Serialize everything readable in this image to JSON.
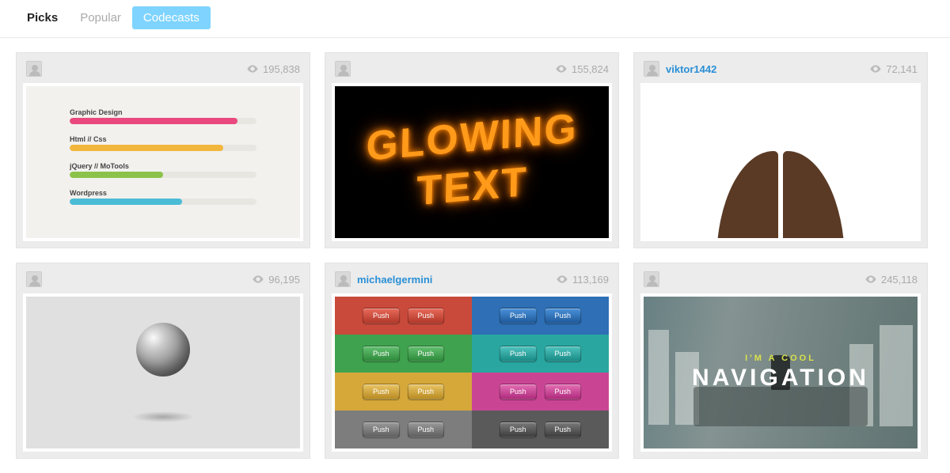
{
  "tabs": {
    "picks": "Picks",
    "popular": "Popular",
    "codecasts": "Codecasts"
  },
  "cards": [
    {
      "author": "",
      "views": "195,838",
      "skills": [
        "Graphic Design",
        "Html // Css",
        "jQuery // MoTools",
        "Wordpress"
      ]
    },
    {
      "author": "",
      "views": "155,824",
      "glow_line1": "GLOWING",
      "glow_line2": "TEXT"
    },
    {
      "author": "viktor1442",
      "views": "72,141"
    },
    {
      "author": "",
      "views": "96,195"
    },
    {
      "author": "michaelgermini",
      "views": "113,169",
      "push_label": "Push"
    },
    {
      "author": "",
      "views": "245,118",
      "hero_sub": "I'M A COOL",
      "hero_title": "NAVIGATION"
    }
  ]
}
